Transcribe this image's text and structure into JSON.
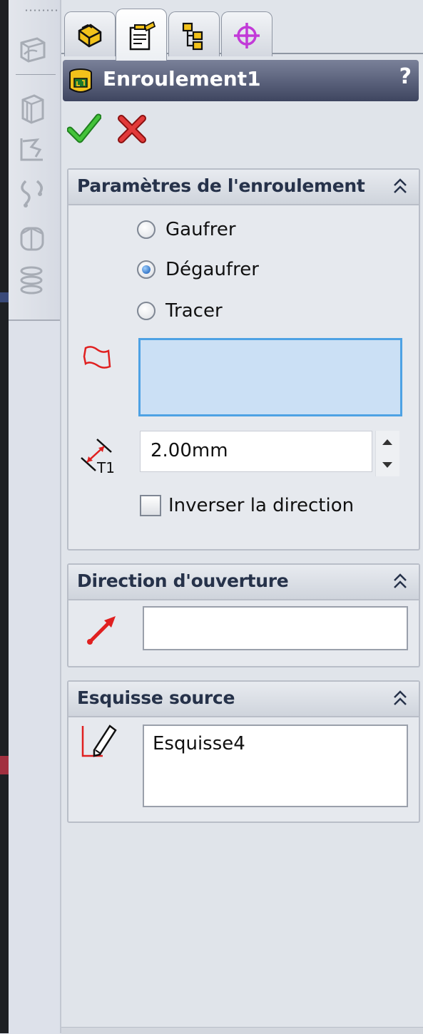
{
  "window": {
    "title": "Enroulement1",
    "help_label": "?"
  },
  "tabs": [
    {
      "name": "feature-manager",
      "icon": "feature-manager-icon",
      "active": false
    },
    {
      "name": "property-manager",
      "icon": "property-manager-icon",
      "active": true
    },
    {
      "name": "configuration-manager",
      "icon": "configuration-manager-icon",
      "active": false
    },
    {
      "name": "dimxpert-manager",
      "icon": "dimxpert-crosshair-icon",
      "active": false
    }
  ],
  "actions": {
    "ok": "check-icon",
    "cancel": "x-icon"
  },
  "toolbar": {
    "items": [
      "sketch-plane-icon",
      "extrude-icon",
      "split-line-icon",
      "curve-icon",
      "fillet-icon",
      "helix-icon"
    ]
  },
  "groups": {
    "wrap_params": {
      "title": "Paramètres de l'enroulement",
      "options": [
        "Gaufrer",
        "Dégaufrer",
        "Tracer"
      ],
      "selected": "Dégaufrer",
      "faces_value": "",
      "thickness_value": "2.00mm",
      "thickness_icon_label": "T1",
      "reverse_label": "Inverser la direction",
      "reverse_checked": false
    },
    "pull_direction": {
      "title": "Direction d'ouverture",
      "value": ""
    },
    "source_sketch": {
      "title": "Esquisse source",
      "value": "Esquisse4"
    }
  },
  "colors": {
    "title_bar": "#4a5270",
    "selection_blue": "#cbe0f5",
    "selection_border": "#4ea2e4",
    "ok_green": "#2aa52a",
    "cancel_red": "#d62020",
    "accent_red": "#e02020"
  }
}
